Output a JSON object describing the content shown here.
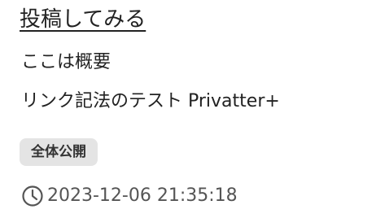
{
  "post": {
    "title": "投稿してみる",
    "summary": "ここは概要",
    "body": "リンク記法のテスト Privatter+",
    "visibility_badge": "全体公開",
    "timestamp": "2023-12-06 21:35:18"
  },
  "icons": {
    "timestamp": "clock-icon"
  },
  "colors": {
    "text": "#222222",
    "badge_bg": "#e4e4e4",
    "timestamp_text": "#555555"
  }
}
